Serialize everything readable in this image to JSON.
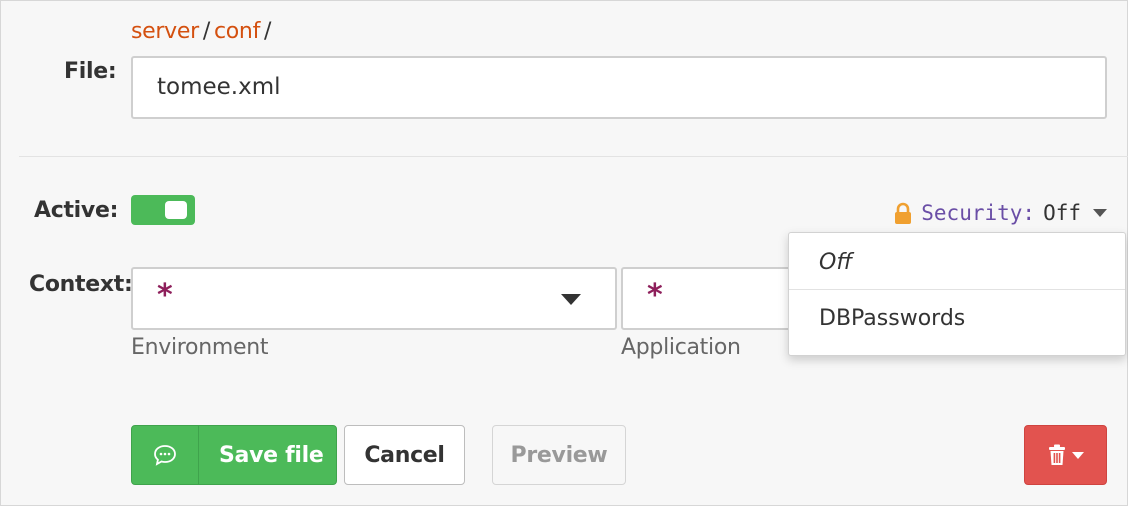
{
  "breadcrumb": {
    "items": [
      "server",
      "conf"
    ],
    "separator": "/"
  },
  "file": {
    "label": "File:",
    "value": "tomee.xml"
  },
  "active": {
    "label": "Active:",
    "on": true
  },
  "security": {
    "icon": "lock-icon",
    "label": "Security:",
    "value": "Off",
    "menu": [
      "Off",
      "DBPasswords"
    ]
  },
  "context": {
    "label": "Context:",
    "environment": {
      "value": "*",
      "help": "Environment"
    },
    "application": {
      "value": "*",
      "help": "Application"
    }
  },
  "buttons": {
    "save": "Save file",
    "cancel": "Cancel",
    "preview": "Preview"
  },
  "colors": {
    "accent_green": "#4cba59",
    "breadcrumb_orange": "#d4500f",
    "danger_red": "#e2534f",
    "security_purple": "#6a4ea6",
    "lock_orange": "#f0a030"
  }
}
